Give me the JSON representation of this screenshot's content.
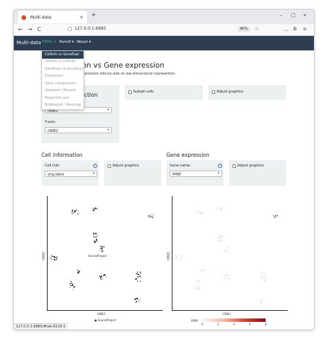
{
  "browser": {
    "tab_title": "Multi-data",
    "tab_close": "×",
    "new_tab": "+",
    "back": "←",
    "forward": "→",
    "reload": "C",
    "url": "127.0.0.1:6885",
    "zoom": "80%",
    "status_url": "127.0.0.1:6885/#tab-8219-1",
    "win_min": "–",
    "win_max": "□",
    "win_close": "×"
  },
  "app": {
    "brand": "Multi-data",
    "menus": [
      "PBMC ▾",
      "Panc8 ▾",
      "About ▾"
    ],
    "dropdown": [
      "CellInfo vs GeneExpr",
      "CellInfo vs CellInfo",
      "GeneExpr vs GeneExpr",
      "Expression",
      "Gene coexpression",
      "Violinplot / Boxplot",
      "Proportion plot",
      "Bubbleplot / Heatmap"
    ]
  },
  "page": {
    "title": "on vs Gene expression",
    "subtitle": "xpression side-by-side on low-dimensional represention."
  },
  "dimred": {
    "title": "ction",
    "x_value": "tSNE1",
    "y_label": "Y-axis:",
    "y_value": "tSNE2"
  },
  "subset_label": "Subset cells",
  "adjust_graphics": "Adjust graphics",
  "cell_info": {
    "title": "Cell information",
    "label": "Cell info:",
    "value": "orig.ident",
    "help": "?",
    "adjust": "Adjust graphics",
    "plot_center": "SeuratProject",
    "xlabel": "tSNE1",
    "ylabel": "tSNE2",
    "legend": "SeuratProject"
  },
  "gene_expr": {
    "title": "Gene expression",
    "label": "Gene name:",
    "value": "PPBP",
    "help": "?",
    "adjust": "Adjust graphics",
    "xlabel": "tSNE1",
    "ylabel": "tSNE2",
    "legend_title": "PPBP",
    "colorbar_ticks": [
      "0",
      "2",
      "4",
      "6",
      "8"
    ]
  }
}
